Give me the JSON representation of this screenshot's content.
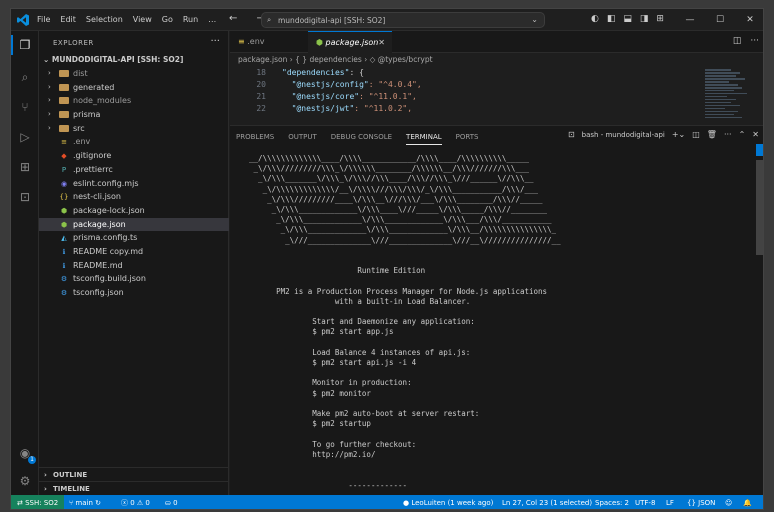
{
  "menu": [
    "File",
    "Edit",
    "Selection",
    "View",
    "Go",
    "Run",
    "…"
  ],
  "nav_arrows": "← →",
  "command_center": "mundodigital-api [SSH: SO2]",
  "window_controls": [
    "—",
    "☐",
    "✕"
  ],
  "sidebar": {
    "header": "EXPLORER",
    "root": "MUNDODIGITAL-API [SSH: SO2]",
    "items": [
      {
        "label": "dist",
        "type": "folder",
        "color": "#9d9d9d"
      },
      {
        "label": "generated",
        "type": "folder",
        "color": "#cccccc"
      },
      {
        "label": "node_modules",
        "type": "folder",
        "color": "#9d9d9d"
      },
      {
        "label": "prisma",
        "type": "folder",
        "color": "#cccccc"
      },
      {
        "label": "src",
        "type": "folder",
        "color": "#cccccc"
      },
      {
        "label": ".env",
        "type": "file",
        "color": "#9d9d9d",
        "icon": "≡",
        "icon_color": "#e6c84b"
      },
      {
        "label": ".gitignore",
        "type": "file",
        "color": "#cccccc",
        "icon": "◆",
        "icon_color": "#e44d26"
      },
      {
        "label": ".prettierrc",
        "type": "file",
        "color": "#cccccc",
        "icon": "P",
        "icon_color": "#56b3b4"
      },
      {
        "label": "eslint.config.mjs",
        "type": "file",
        "color": "#cccccc",
        "icon": "◉",
        "icon_color": "#8080f2"
      },
      {
        "label": "nest-cli.json",
        "type": "file",
        "color": "#cccccc",
        "icon": "{}",
        "icon_color": "#e6c84b"
      },
      {
        "label": "package-lock.json",
        "type": "file",
        "color": "#cccccc",
        "icon": "⬢",
        "icon_color": "#8bc34a"
      },
      {
        "label": "package.json",
        "type": "file",
        "color": "#ffffff",
        "icon": "⬢",
        "icon_color": "#8bc34a",
        "selected": true
      },
      {
        "label": "prisma.config.ts",
        "type": "file",
        "color": "#cccccc",
        "icon": "◭",
        "icon_color": "#4fc3f7"
      },
      {
        "label": "README copy.md",
        "type": "file",
        "color": "#cccccc",
        "icon": "ℹ",
        "icon_color": "#42a5f5"
      },
      {
        "label": "README.md",
        "type": "file",
        "color": "#cccccc",
        "icon": "ℹ",
        "icon_color": "#42a5f5"
      },
      {
        "label": "tsconfig.build.json",
        "type": "file",
        "color": "#cccccc",
        "icon": "⚙",
        "icon_color": "#42a5f5"
      },
      {
        "label": "tsconfig.json",
        "type": "file",
        "color": "#cccccc",
        "icon": "⚙",
        "icon_color": "#42a5f5"
      }
    ],
    "outline": "OUTLINE",
    "timeline": "TIMELINE"
  },
  "tabs": [
    {
      "label": ".env",
      "active": false,
      "icon": "≡"
    },
    {
      "label": "package.json",
      "active": true,
      "icon": "⬢"
    }
  ],
  "breadcrumbs": "package.json  ›  { } dependencies  ›  ◇ @types/bcrypt",
  "code": [
    {
      "ln": "18",
      "key": "\"dependencies\"",
      "rest": ": {"
    },
    {
      "ln": "20",
      "key": "\"@nestjs/config\"",
      "rest": ": \"^4.0.4\","
    },
    {
      "ln": "21",
      "key": "\"@nestjs/core\"",
      "rest": ": \"^11.0.1\","
    },
    {
      "ln": "22",
      "key": "\"@nestjs/jwt\"",
      "rest": ": \"^11.0.2\","
    }
  ],
  "panel": {
    "tabs": [
      "PROBLEMS",
      "OUTPUT",
      "DEBUG CONSOLE",
      "TERMINAL",
      "PORTS"
    ],
    "active_tab": "TERMINAL",
    "terminal_name": "bash - mundodigital-api"
  },
  "terminal_text": "  __/\\\\\\\\\\\\\\\\\\\\\\\\\\____/\\\\\\\\____________/\\\\\\\\____/\\\\\\\\\\\\\\\\\\\\_____\n   _\\/\\\\\\/////////\\\\\\_\\/\\\\\\\\\\\\________/\\\\\\\\\\\\__/\\\\\\///////\\\\\\___\n    _\\/\\\\\\_______\\/\\\\\\_\\/\\\\\\//\\\\\\____/\\\\\\//\\\\\\_\\///______\\//\\\\\\__\n     _\\/\\\\\\\\\\\\\\\\\\\\\\\\\\/__\\/\\\\\\\\///\\\\\\/\\\\\\/_\\/\\\\\\___________/\\\\\\/___\n      _\\/\\\\\\/////////____\\/\\\\\\__\\///\\\\\\/___\\/\\\\\\________/\\\\\\//_____\n       _\\/\\\\\\_____________\\/\\\\\\____\\///_____\\/\\\\\\_____/\\\\\\//________\n        _\\/\\\\\\_____________\\/\\\\\\_____________\\/\\\\\\___/\\\\\\/___________\n         _\\/\\\\\\_____________\\/\\\\\\_____________\\/\\\\\\__/\\\\\\\\\\\\\\\\\\\\\\\\\\\\\\_\n          _\\///______________\\///______________\\///__\\///////////////__\n\n\n                          Runtime Edition\n\n        PM2 is a Production Process Manager for Node.js applications\n                     with a built-in Load Balancer.\n\n                Start and Daemonize any application:\n                $ pm2 start app.js\n\n                Load Balance 4 instances of api.js:\n                $ pm2 start api.js -i 4\n\n                Monitor in production:\n                $ pm2 monitor\n\n                Make pm2 auto-boot at server restart:\n                $ pm2 startup\n\n                To go further checkout:\n                http://pm2.io/\n\n\n                        -------------",
  "status": {
    "remote": "⇄ SSH: SO2",
    "branch": "⑂ main ↻",
    "problems": "ⓧ 0 ⚠ 0",
    "ports": "⛀ 0",
    "blame": "● LeoLuiten (1 week ago)",
    "position": "Ln 27, Col 23 (1 selected)",
    "spaces": "Spaces: 2",
    "encoding": "UTF-8",
    "eol": "LF",
    "language": "{} JSON",
    "copilot": "☺",
    "bell": "🔔"
  },
  "colors": {
    "accent": "#0078d4",
    "remote": "#16825d",
    "editor_bg": "#1e1e1e",
    "sidebar_bg": "#181818"
  }
}
